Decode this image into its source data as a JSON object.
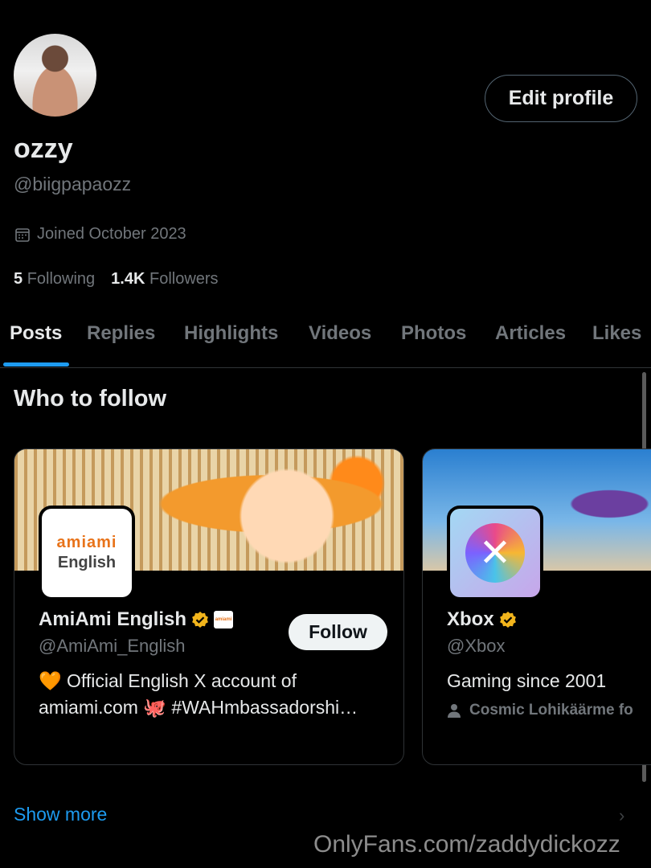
{
  "profile": {
    "display_name": "ozzy",
    "handle": "@biigpapaozz",
    "joined": "Joined October 2023",
    "following_count": "5",
    "following_label": "Following",
    "followers_count": "1.4K",
    "followers_label": "Followers",
    "edit_label": "Edit profile"
  },
  "tabs": [
    "Posts",
    "Replies",
    "Highlights",
    "Videos",
    "Photos",
    "Articles",
    "Likes"
  ],
  "who_to_follow": {
    "title": "Who to follow",
    "cards": [
      {
        "name": "AmiAmi English",
        "handle": "@AmiAmi_English",
        "bio_line1": "🧡 Official English X account of",
        "bio_line2": "amiami.com 🐙 #WAHmbassadorshi…",
        "follow_label": "Follow",
        "logo_top": "amiami",
        "logo_bottom": "English",
        "badge_text": "amiami"
      },
      {
        "name": "Xbox",
        "handle": "@Xbox",
        "bio": "Gaming since 2001",
        "social": "Cosmic Lohikäärme fo"
      }
    ],
    "show_more": "Show more"
  },
  "watermark": "OnlyFans.com/zaddydickozz",
  "colors": {
    "accent": "#1d9bf0",
    "verified": "#f2b51c"
  }
}
